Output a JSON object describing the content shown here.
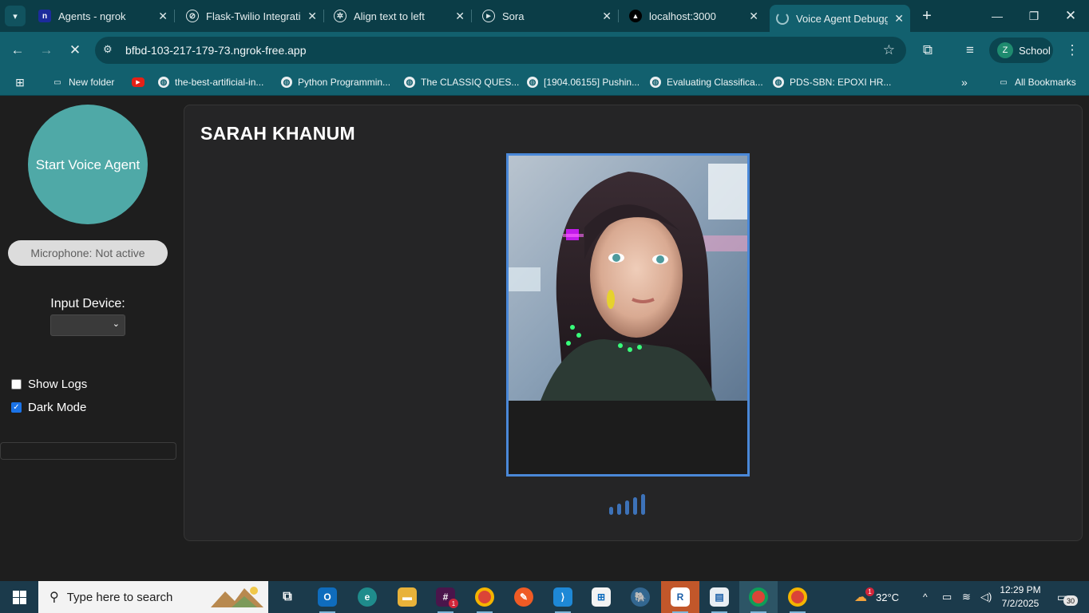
{
  "browser": {
    "tabs": [
      {
        "title": "Agents - ngrok",
        "favicon": "ngrok-icon",
        "active": false
      },
      {
        "title": "Flask-Twilio Integratic",
        "favicon": "openai-icon",
        "active": false
      },
      {
        "title": "Align text to left",
        "favicon": "openai-icon",
        "active": false
      },
      {
        "title": "Sora",
        "favicon": "sora-icon",
        "active": false
      },
      {
        "title": "localhost:3000",
        "favicon": "triangle-icon",
        "active": false
      },
      {
        "title": "Voice Agent Debugg",
        "favicon": "loading-icon",
        "active": true
      }
    ],
    "url": "bfbd-103-217-179-73.ngrok-free.app",
    "profile": {
      "initial": "Z",
      "name": "School"
    },
    "bookmarks": [
      {
        "label": "New folder",
        "icon": "folder-icon"
      },
      {
        "label": "",
        "icon": "youtube-icon"
      },
      {
        "label": "the-best-artificial-in...",
        "icon": "globe-icon"
      },
      {
        "label": "Python Programmin...",
        "icon": "globe-icon"
      },
      {
        "label": "The CLASSIQ QUES...",
        "icon": "globe-icon"
      },
      {
        "label": "[1904.06155] Pushin...",
        "icon": "globe-icon"
      },
      {
        "label": "Evaluating Classifica...",
        "icon": "globe-icon"
      },
      {
        "label": "PDS-SBN: EPOXI HR...",
        "icon": "globe-icon"
      }
    ],
    "all_bookmarks": "All Bookmarks"
  },
  "app": {
    "start_button": "Start Voice Agent",
    "mic_status": "Microphone: Not active",
    "input_device_label": "Input Device:",
    "input_device_value": "",
    "show_logs_label": "Show Logs",
    "show_logs_checked": false,
    "dark_mode_label": "Dark Mode",
    "dark_mode_checked": true,
    "agent_name": "SARAH KHANUM",
    "accent_color": "#4fa9a7",
    "frame_color": "#4a88d8"
  },
  "taskbar": {
    "search_placeholder": "Type here to search",
    "apps": [
      "task-view-icon",
      "outlook-icon",
      "edge-icon",
      "file-explorer-icon",
      "slack-icon",
      "chrome-icon",
      "postman-icon",
      "vscode-icon",
      "store-icon",
      "postgres-icon",
      "rider-icon",
      "window-icon",
      "chrome-profile-icon",
      "chrome-icon"
    ],
    "slack_badge": "1",
    "weather_badge": "1",
    "temperature": "32°C",
    "time": "12:29 PM",
    "date": "7/2/2025",
    "notifications": "30"
  }
}
